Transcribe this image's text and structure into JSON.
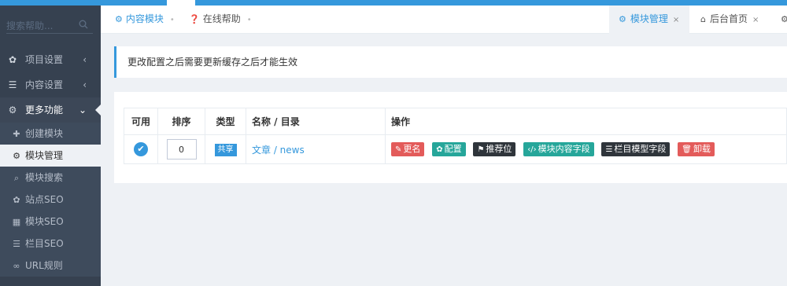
{
  "sidebar": {
    "search_placeholder": "搜索帮助...",
    "items": [
      {
        "label": "项目设置",
        "icon": "gear-icon"
      },
      {
        "label": "内容设置",
        "icon": "list-icon"
      },
      {
        "label": "更多功能",
        "icon": "cogs-icon"
      }
    ],
    "sub_items": [
      {
        "label": "创建模块",
        "icon": "plus-icon"
      },
      {
        "label": "模块管理",
        "icon": "cogs-icon"
      },
      {
        "label": "模块搜索",
        "icon": "search-icon"
      },
      {
        "label": "站点SEO",
        "icon": "gear-icon"
      },
      {
        "label": "模块SEO",
        "icon": "grid-icon"
      },
      {
        "label": "栏目SEO",
        "icon": "list-icon"
      },
      {
        "label": "URL规则",
        "icon": "link-icon"
      }
    ]
  },
  "header": {
    "breadcrumbs": [
      "内容模块",
      "在线帮助"
    ],
    "tabs": [
      "模块管理",
      "后台首页"
    ]
  },
  "notice": "更改配置之后需要更新缓存之后才能生效",
  "table": {
    "headers": [
      "可用",
      "排序",
      "类型",
      "名称 / 目录",
      "操作"
    ],
    "row": {
      "sort": "0",
      "type": "共享",
      "name": "文章 / news"
    },
    "actions": [
      "更名",
      "配置",
      "推荐位",
      "模块内容字段",
      "栏目模型字段",
      "卸载"
    ]
  },
  "colors": {
    "accent": "#3598dc",
    "sidebar": "#364150",
    "danger": "#e35b5a",
    "success": "#26a69a",
    "dark": "#2f353b"
  }
}
